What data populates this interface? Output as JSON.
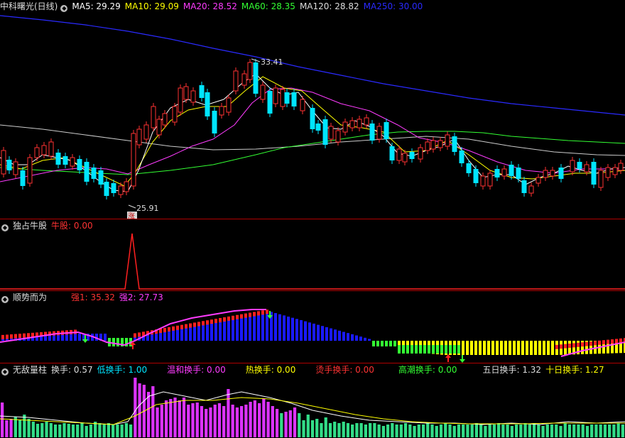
{
  "main": {
    "title": "中科曙光(日线)",
    "ma": [
      {
        "label": "MA5: 29.29",
        "color": "#ffffff"
      },
      {
        "label": "MA10: 29.09",
        "color": "#ffff00"
      },
      {
        "label": "MA20: 28.52",
        "color": "#ff3cff"
      },
      {
        "label": "MA60: 28.35",
        "color": "#33ff33"
      },
      {
        "label": "MA120: 28.82",
        "color": "#dddddd"
      },
      {
        "label": "MA250: 30.00",
        "color": "#2a2aff"
      }
    ],
    "high_label": "33.41",
    "low_label": "25.91",
    "marker": "涨"
  },
  "pane1": {
    "title": "独占牛股",
    "item": "牛股: 0.00"
  },
  "pane2": {
    "title": "顺势而为",
    "s1": "强1: 35.32",
    "s2": "强2: 27.73"
  },
  "pane3": {
    "title": "无敌量柱",
    "items": [
      {
        "label": "换手: 0.57",
        "color": "#dddddd"
      },
      {
        "label": "低换手: 1.00",
        "color": "#00e5ff"
      },
      {
        "label": "温和换手: 0.00",
        "color": "#ff3cff"
      },
      {
        "label": "热换手: 0.00",
        "color": "#ffff00"
      },
      {
        "label": "烫手换手: 0.00",
        "color": "#ff3333"
      },
      {
        "label": "高潮换手: 0.00",
        "color": "#33ff33"
      },
      {
        "label": "五日换手: 1.32",
        "color": "#dddddd"
      },
      {
        "label": "十日换手: 1.27",
        "color": "#ffff00"
      }
    ]
  },
  "chart_data": [
    {
      "type": "candlestick",
      "title": "中科曙光(日线)",
      "high": 33.41,
      "low": 25.91,
      "series": [
        {
          "name": "MA5",
          "value": 29.29
        },
        {
          "name": "MA10",
          "value": 29.09
        },
        {
          "name": "MA20",
          "value": 28.52
        },
        {
          "name": "MA60",
          "value": 28.35
        },
        {
          "name": "MA120",
          "value": 28.82
        },
        {
          "name": "MA250",
          "value": 30.0
        }
      ]
    },
    {
      "type": "line",
      "title": "独占牛股",
      "series": [
        {
          "name": "牛股",
          "value": 0.0
        }
      ]
    },
    {
      "type": "bar",
      "title": "顺势而为",
      "series": [
        {
          "name": "强1",
          "value": 35.32
        },
        {
          "name": "强2",
          "value": 27.73
        }
      ]
    },
    {
      "type": "bar",
      "title": "无敌量柱",
      "series": [
        {
          "name": "换手",
          "value": 0.57
        },
        {
          "name": "低换手",
          "value": 1.0
        },
        {
          "name": "温和换手",
          "value": 0.0
        },
        {
          "name": "热换手",
          "value": 0.0
        },
        {
          "name": "烫手换手",
          "value": 0.0
        },
        {
          "name": "高潮换手",
          "value": 0.0
        },
        {
          "name": "五日换手",
          "value": 1.32
        },
        {
          "name": "十日换手",
          "value": 1.27
        }
      ]
    }
  ]
}
